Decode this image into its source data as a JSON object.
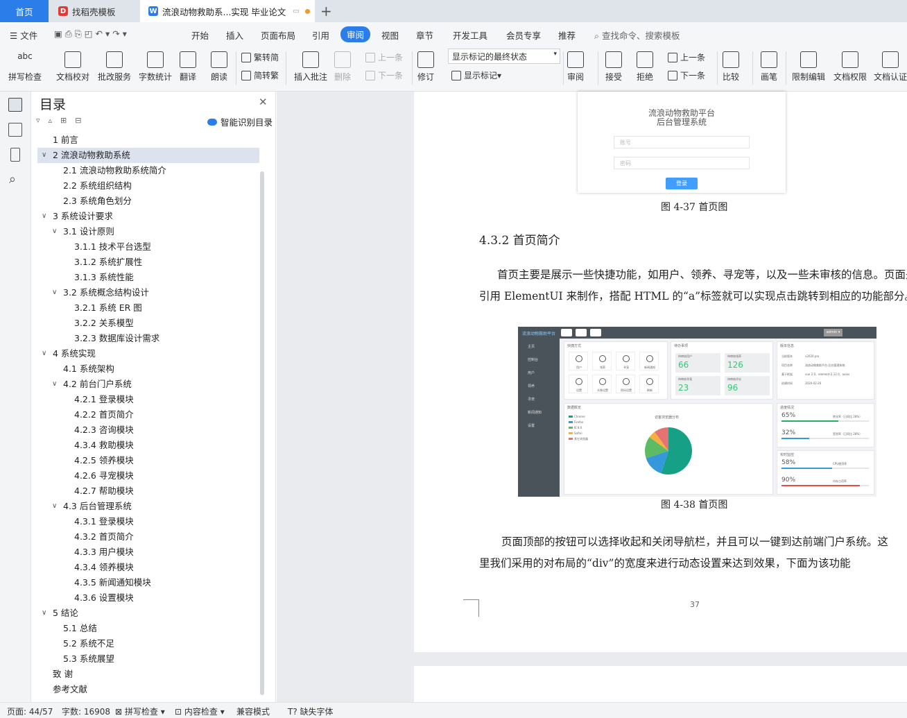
{
  "tabs": {
    "home": "首页",
    "template": "找稻壳模板",
    "doc": "流浪动物救助系...实现 毕业论文"
  },
  "menu": {
    "file": "文件",
    "items": [
      "开始",
      "插入",
      "页面布局",
      "引用",
      "审阅",
      "视图",
      "章节",
      "开发工具",
      "会员专享",
      "推荐"
    ],
    "active": "审阅",
    "search": "查找命令、搜索模板"
  },
  "ribbon": {
    "spell": "拼写检查",
    "proof": "文档校对",
    "annotate_service": "批改服务",
    "word_count": "字数统计",
    "translate": "翻译",
    "read": "朗读",
    "trad": "繁转简",
    "simp": "简转繁",
    "insert_comment": "插入批注",
    "delete": "删除",
    "prev": "上一条",
    "next": "下一条",
    "revise": "修订",
    "markup_state": "显示标记的最终状态",
    "show_markup": "显示标记",
    "review": "审阅",
    "accept": "接受",
    "reject": "拒绝",
    "prev2": "上一条",
    "next2": "下一条",
    "compare": "比较",
    "pen": "画笔",
    "restrict": "限制编辑",
    "permission": "文档权限",
    "certify": "文档认证"
  },
  "toc": {
    "title": "目录",
    "smart": "智能识别目录",
    "items": [
      {
        "text": "1 前言",
        "level": 1,
        "arrow": ""
      },
      {
        "text": "2 流浪动物救助系统",
        "level": 1,
        "arrow": "v",
        "selected": true
      },
      {
        "text": "2.1 流浪动物救助系统简介",
        "level": 2,
        "arrow": ""
      },
      {
        "text": "2.2 系统组织结构",
        "level": 2,
        "arrow": ""
      },
      {
        "text": "2.3 系统角色划分",
        "level": 2,
        "arrow": ""
      },
      {
        "text": "3 系统设计要求",
        "level": 1,
        "arrow": "v"
      },
      {
        "text": "3.1 设计原则",
        "level": 2,
        "arrow": "v"
      },
      {
        "text": "3.1.1 技术平台选型",
        "level": 3,
        "arrow": ""
      },
      {
        "text": "3.1.2 系统扩展性",
        "level": 3,
        "arrow": ""
      },
      {
        "text": "3.1.3 系统性能",
        "level": 3,
        "arrow": ""
      },
      {
        "text": "3.2 系统概念结构设计",
        "level": 2,
        "arrow": "v"
      },
      {
        "text": "3.2.1 系统 ER 图",
        "level": 3,
        "arrow": ""
      },
      {
        "text": "3.2.2 关系模型",
        "level": 3,
        "arrow": ""
      },
      {
        "text": "3.2.3 数据库设计需求",
        "level": 3,
        "arrow": ""
      },
      {
        "text": "4 系统实现",
        "level": 1,
        "arrow": "v"
      },
      {
        "text": "4.1 系统架构",
        "level": 2,
        "arrow": ""
      },
      {
        "text": "4.2 前台门户系统",
        "level": 2,
        "arrow": "v"
      },
      {
        "text": "4.2.1 登录模块",
        "level": 3,
        "arrow": ""
      },
      {
        "text": "4.2.2 首页简介",
        "level": 3,
        "arrow": ""
      },
      {
        "text": "4.2.3 咨询模块",
        "level": 3,
        "arrow": ""
      },
      {
        "text": "4.3.4 救助模块",
        "level": 3,
        "arrow": ""
      },
      {
        "text": "4.2.5 领养模块",
        "level": 3,
        "arrow": ""
      },
      {
        "text": "4.2.6 寻宠模块",
        "level": 3,
        "arrow": ""
      },
      {
        "text": "4.2.7 帮助模块",
        "level": 3,
        "arrow": ""
      },
      {
        "text": "4.3 后台管理系统",
        "level": 2,
        "arrow": "v"
      },
      {
        "text": "4.3.1 登录模块",
        "level": 3,
        "arrow": ""
      },
      {
        "text": "4.3.2 首页简介",
        "level": 3,
        "arrow": ""
      },
      {
        "text": "4.3.3 用户模块",
        "level": 3,
        "arrow": ""
      },
      {
        "text": "4.3.4 领养模块",
        "level": 3,
        "arrow": ""
      },
      {
        "text": "4.3.5 新闻通知模块",
        "level": 3,
        "arrow": ""
      },
      {
        "text": "4.3.6 设置模块",
        "level": 3,
        "arrow": ""
      },
      {
        "text": "5 结论",
        "level": 1,
        "arrow": "v"
      },
      {
        "text": "5.1 总结",
        "level": 2,
        "arrow": ""
      },
      {
        "text": "5.2 系统不足",
        "level": 2,
        "arrow": ""
      },
      {
        "text": "5.3 系统展望",
        "level": 2,
        "arrow": ""
      },
      {
        "text": "致  谢",
        "level": 1,
        "arrow": ""
      },
      {
        "text": "参考文献",
        "level": 1,
        "arrow": ""
      }
    ]
  },
  "doc": {
    "login": {
      "title1": "流浪动物救助平台",
      "title2": "后台管理系统",
      "user_ph": "账号",
      "pwd_ph": "密码",
      "btn": "登录"
    },
    "fig37": "图 4-37   首页图",
    "heading": "4.3.2  首页简介",
    "para1_l1": "首页主要是展示一些快捷功能，如用户、领养、寻宠等，以及一些未审核的信息。页面是",
    "para1_l2": "引用 ElementUI 来制作，搭配 HTML 的“a”标签就可以实现点击跳转到相应的功能部分。",
    "fig38": "图 4-38   首页图",
    "para2_l1": "页面顶部的按钮可以选择收起和关闭导航栏，并且可以一键到达前端门户系统。这",
    "para2_l2": "里我们采用的对布局的“div”的宽度来进行动态设置来达到效果，下面为该功能",
    "page_no": "37",
    "shot": {
      "brand": "流浪动物救助平台",
      "admin": "admin ▾",
      "side": [
        "主页",
        "控制台",
        "用户",
        "领养",
        "寻宠",
        "新闻通知",
        "设置"
      ],
      "quick_title": "快捷方式",
      "quick": [
        "用户",
        "领养",
        "寻宠",
        "新闻通知",
        "设置",
        "头像设置",
        "密码设置",
        "刷新"
      ],
      "todo_title": "待办事项",
      "todo": [
        {
          "label": "待审核用户",
          "value": "66"
        },
        {
          "label": "待审核领养",
          "value": "126"
        },
        {
          "label": "待审核寻宠",
          "value": "23"
        },
        {
          "label": "待审核评论",
          "value": "96"
        }
      ],
      "info_title": "版本信息",
      "info": [
        [
          "当前版本",
          "v2020.pro"
        ],
        [
          "项目名称",
          "流浪动物救助平台-后台管理系统"
        ],
        [
          "基于框架",
          "vue 2.0、element-2.12.0、axios"
        ],
        [
          "创建时间",
          "2020-02-26"
        ]
      ],
      "data_title": "数据概览",
      "pie_title": "访客浏览器分布",
      "legend": [
        "Chrome",
        "Firefox",
        "IE 8.0",
        "Safari",
        "其它浏览器"
      ],
      "pie_colors": [
        "#16a085",
        "#3498db",
        "#5dbb63",
        "#f5b041",
        "#e57373"
      ],
      "pie_values": [
        55,
        15,
        15,
        5,
        10
      ],
      "prog_title": "进度情况",
      "prog": [
        {
          "v": "65%",
          "t": "转化率（日同比 28%）",
          "c": "#27ae60"
        },
        {
          "v": "32%",
          "t": "签到率（日同比 28%）",
          "c": "#3498db"
        }
      ],
      "mon_title": "实时监控",
      "mon": [
        {
          "v": "58%",
          "t": "CPU使用率",
          "c": "#3498db"
        },
        {
          "v": "90%",
          "t": "内存占用率",
          "c": "#e74c3c"
        }
      ]
    }
  },
  "status": {
    "page": "页面: 44/57",
    "words": "字数: 16908",
    "spell": "拼写检查",
    "content": "内容检查",
    "compat": "兼容模式",
    "font": "缺失字体"
  }
}
